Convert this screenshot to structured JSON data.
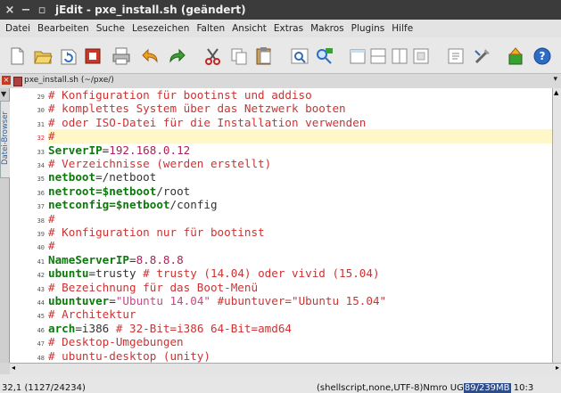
{
  "window": {
    "title": "jEdit - pxe_install.sh (geändert)",
    "controls": [
      "×",
      "−",
      "▫"
    ]
  },
  "menu": [
    "Datei",
    "Bearbeiten",
    "Suche",
    "Lesezeichen",
    "Falten",
    "Ansicht",
    "Extras",
    "Makros",
    "Plugins",
    "Hilfe"
  ],
  "toolbar": {
    "icons": [
      "new-file-icon",
      "open-folder-icon",
      "reload-icon",
      "close-file-icon",
      "print-icon",
      "undo-icon",
      "redo-icon",
      "cut-icon",
      "copy-icon",
      "paste-icon",
      "search-icon",
      "replace-icon",
      "new-view-icon",
      "split-horizontal-icon",
      "split-vertical-icon",
      "unsplit-icon",
      "buffer-options-icon",
      "global-options-icon",
      "plugin-manager-icon",
      "help-icon"
    ]
  },
  "tab": {
    "filename": "pxe_install.sh (~/pxe/)"
  },
  "sidebar": {
    "label": "Datei-Browser"
  },
  "editor": {
    "lines": [
      {
        "num": "29",
        "parts": [
          {
            "t": "# Konfiguration für bootinst und addiso",
            "c": "comment"
          }
        ]
      },
      {
        "num": "30",
        "parts": [
          {
            "t": "# komplettes System über das Netzwerk booten",
            "c": "comment"
          }
        ]
      },
      {
        "num": "31",
        "parts": [
          {
            "t": "# oder ISO-Datei für die Installation verwenden",
            "c": "comment"
          }
        ]
      },
      {
        "num": "32",
        "parts": [
          {
            "t": "#",
            "c": "comment"
          }
        ],
        "current": true
      },
      {
        "num": "33",
        "parts": [
          {
            "t": "ServerIP",
            "c": "var"
          },
          {
            "t": "=",
            "c": "val"
          },
          {
            "t": "192.168.0.12",
            "c": "num"
          }
        ]
      },
      {
        "num": "34",
        "parts": [
          {
            "t": "# Verzeichnisse (werden erstellt)",
            "c": "comment"
          }
        ]
      },
      {
        "num": "35",
        "parts": [
          {
            "t": "netboot",
            "c": "var"
          },
          {
            "t": "=/netboot",
            "c": "val"
          }
        ]
      },
      {
        "num": "36",
        "parts": [
          {
            "t": "netroot",
            "c": "var"
          },
          {
            "t": "=$netboot",
            "c": "var"
          },
          {
            "t": "/root",
            "c": "val"
          }
        ]
      },
      {
        "num": "37",
        "parts": [
          {
            "t": "netconfig",
            "c": "var"
          },
          {
            "t": "=$netboot",
            "c": "var"
          },
          {
            "t": "/config",
            "c": "val"
          }
        ]
      },
      {
        "num": "38",
        "parts": [
          {
            "t": "#",
            "c": "comment"
          }
        ]
      },
      {
        "num": "39",
        "parts": [
          {
            "t": "# Konfiguration nur für bootinst",
            "c": "comment"
          }
        ]
      },
      {
        "num": "40",
        "parts": [
          {
            "t": "#",
            "c": "comment"
          }
        ]
      },
      {
        "num": "41",
        "parts": [
          {
            "t": "NameServerIP",
            "c": "var"
          },
          {
            "t": "=",
            "c": "val"
          },
          {
            "t": "8.8.8.8",
            "c": "num"
          }
        ]
      },
      {
        "num": "42",
        "parts": [
          {
            "t": "ubuntu",
            "c": "var"
          },
          {
            "t": "=trusty ",
            "c": "val"
          },
          {
            "t": "# trusty (14.04) oder vivid (15.04)",
            "c": "comment"
          }
        ]
      },
      {
        "num": "43",
        "parts": [
          {
            "t": "# Bezeichnung für das Boot-Menü",
            "c": "comment"
          }
        ]
      },
      {
        "num": "44",
        "parts": [
          {
            "t": "ubuntuver",
            "c": "var"
          },
          {
            "t": "=",
            "c": "val"
          },
          {
            "t": "\"Ubuntu 14.04\"",
            "c": "str"
          },
          {
            "t": " #ubuntuver=\"Ubuntu 15.04\"",
            "c": "comment"
          }
        ]
      },
      {
        "num": "45",
        "parts": [
          {
            "t": "# Architektur",
            "c": "comment"
          }
        ]
      },
      {
        "num": "46",
        "parts": [
          {
            "t": "arch",
            "c": "var"
          },
          {
            "t": "=i386 ",
            "c": "val"
          },
          {
            "t": "# 32-Bit=i386 64-Bit=amd64",
            "c": "comment"
          }
        ]
      },
      {
        "num": "47",
        "parts": [
          {
            "t": "# Desktop-Umgebungen",
            "c": "comment"
          }
        ]
      },
      {
        "num": "48",
        "parts": [
          {
            "t": "# ubuntu-desktop (unity)",
            "c": "comment"
          }
        ]
      }
    ]
  },
  "status": {
    "position": "32,1 (1127/24234)",
    "mode": "(shellscript,none,UTF-8)Nmro UG",
    "memory": "89/239MB",
    "time": "10:3"
  },
  "colors": {
    "comment": "#cc3333",
    "keyword": "#0a7a0a",
    "string": "#cc4488",
    "number": "#aa2255",
    "titlebar": "#3b3b3b"
  }
}
